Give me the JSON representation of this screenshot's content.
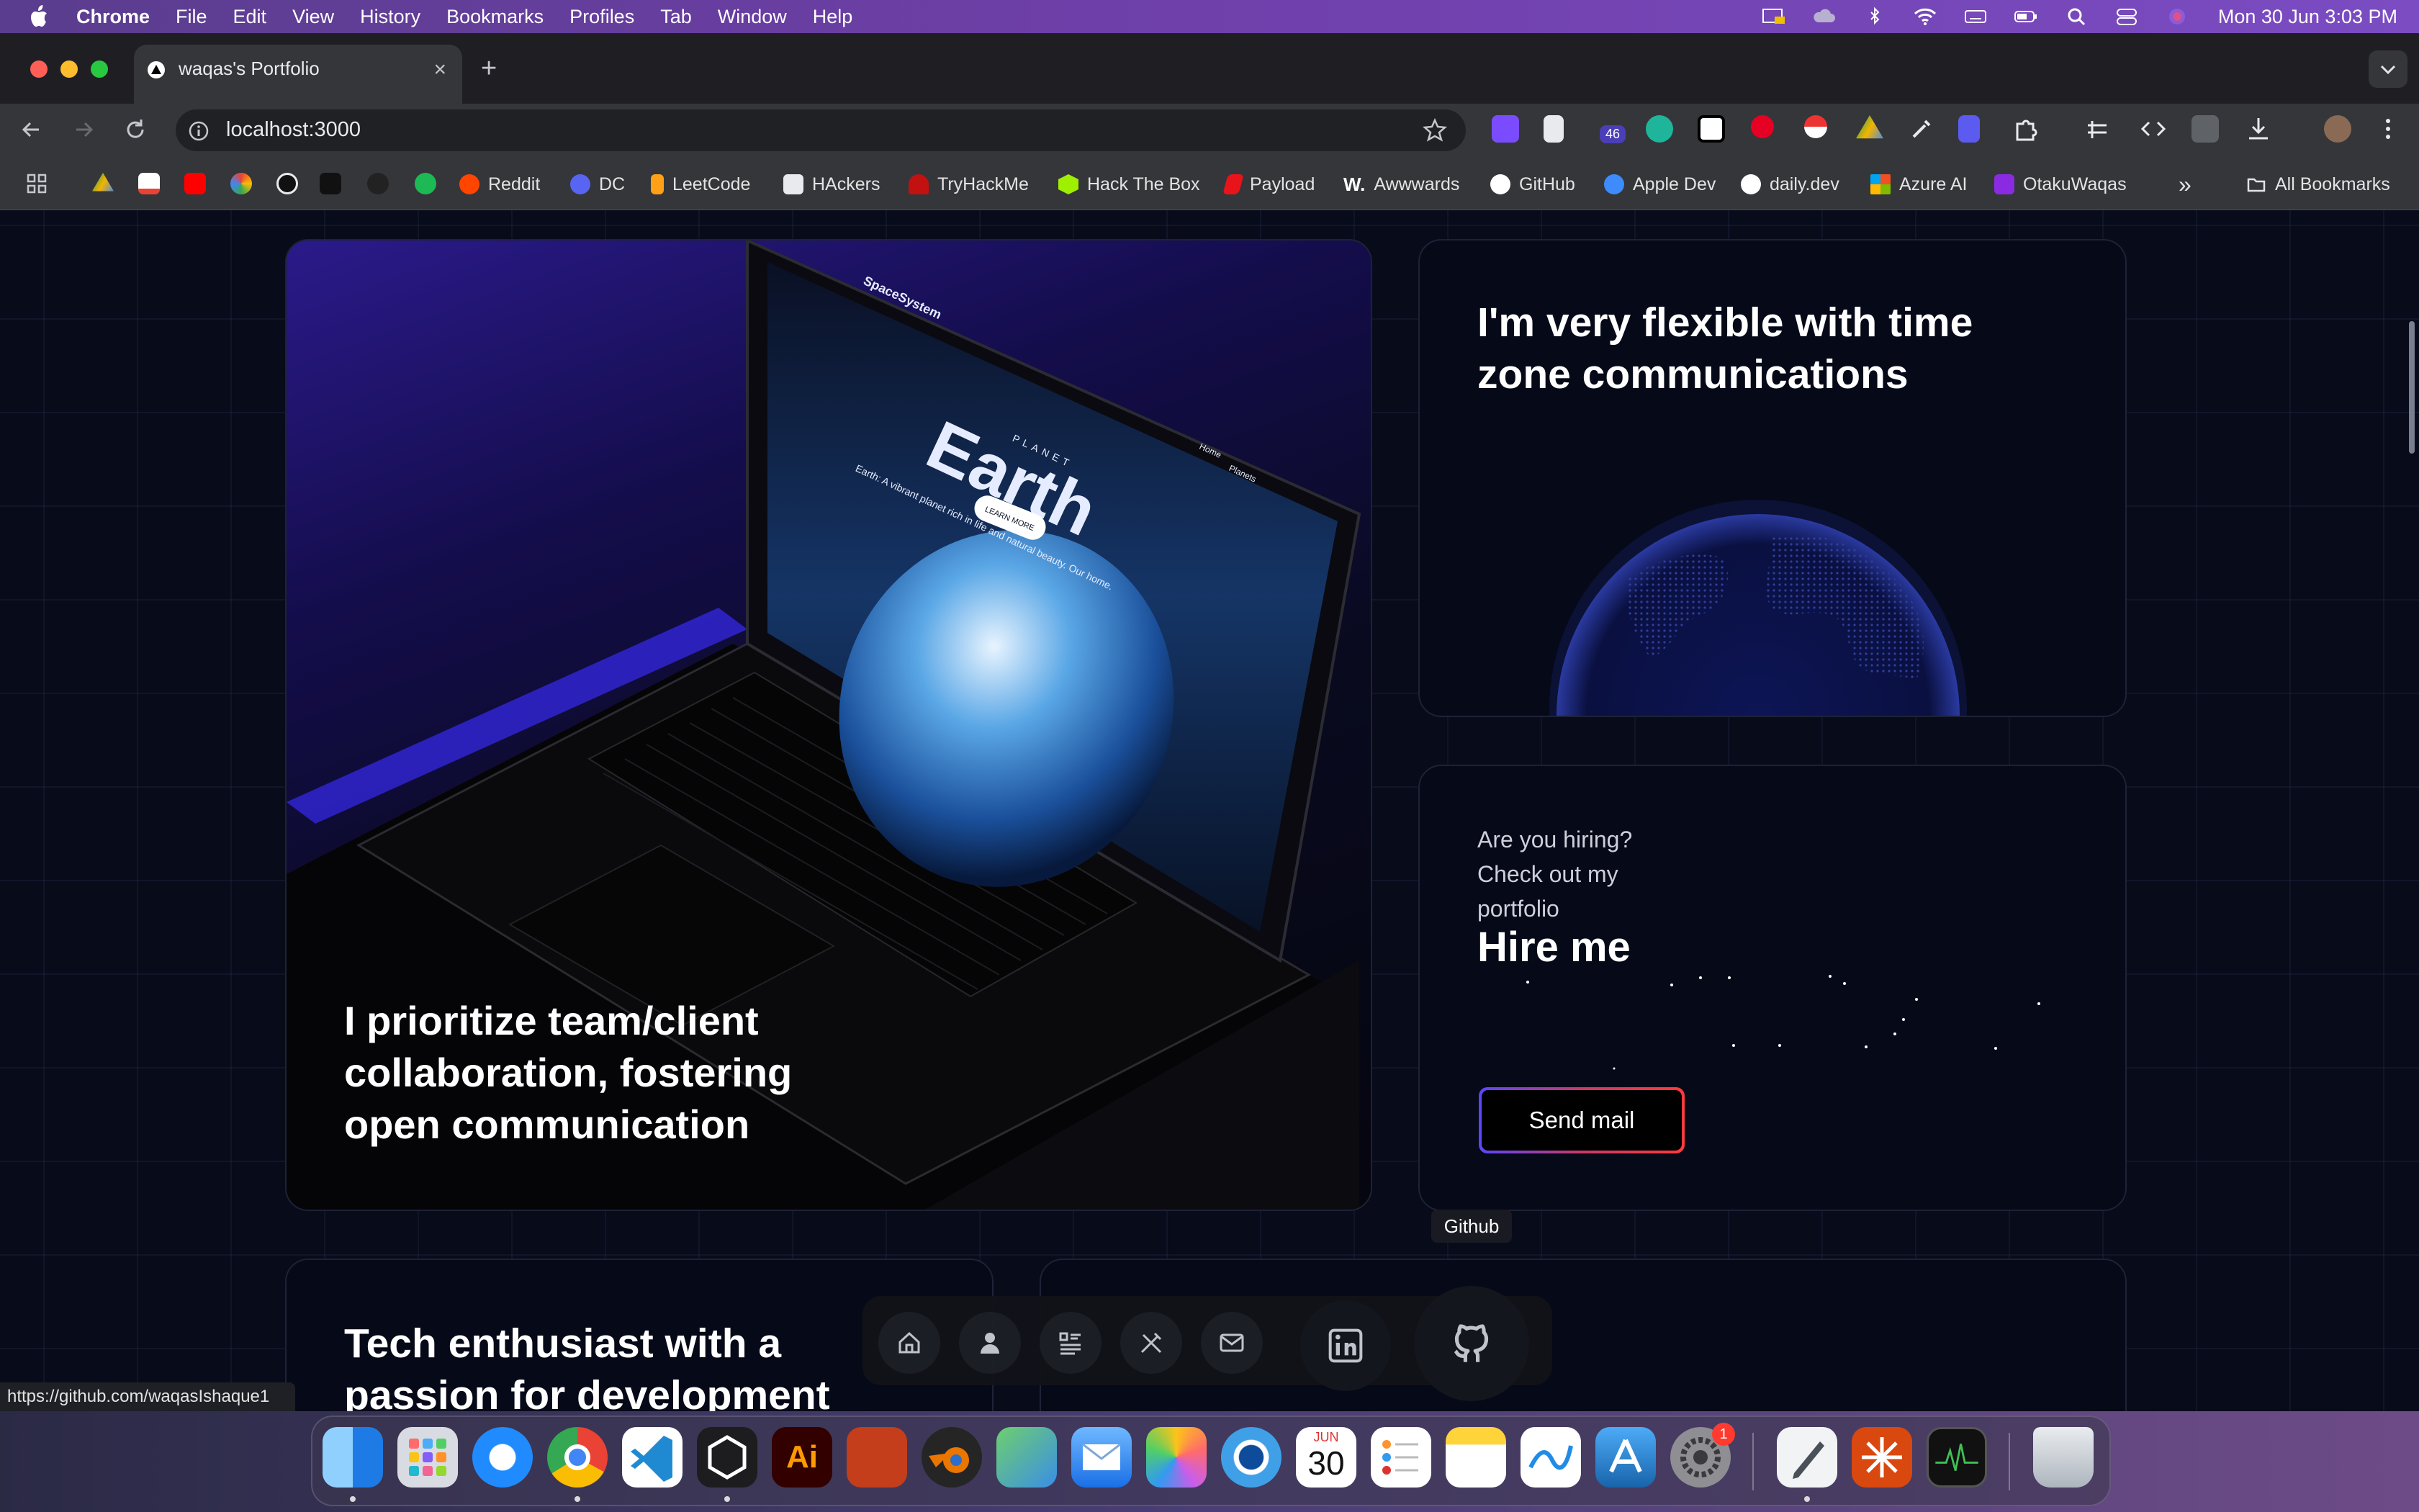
{
  "menubar": {
    "app_name": "Chrome",
    "menus": [
      "File",
      "Edit",
      "View",
      "History",
      "Bookmarks",
      "Profiles",
      "Tab",
      "Window",
      "Help"
    ],
    "clock": "Mon 30 Jun  3:03 PM"
  },
  "browser": {
    "tab_title": "waqas's Portfolio",
    "new_tab_symbol": "+",
    "close_symbol": "×",
    "url": "localhost:3000",
    "extension_badge": "46",
    "bookmarks": [
      "Reddit",
      "DC",
      "LeetCode",
      "HAckers",
      "TryHackMe",
      "Hack The Box",
      "Payload",
      "Awwwards",
      "GitHub",
      "Apple Dev",
      "daily.dev",
      "Azure AI",
      "OtakuWaqas"
    ],
    "all_bookmarks": "All Bookmarks",
    "overflow": "»"
  },
  "page": {
    "card_laptop": {
      "heading": "I prioritize team/client collaboration, fostering open communication",
      "screen_brand": "SpaceSystem",
      "screen_planet_label": "PLANET",
      "screen_title": "Earth",
      "screen_tagline": "Earth: A vibrant planet rich in life and natural beauty. Our home.",
      "screen_button": "LEARN MORE",
      "screen_nav": [
        "Home",
        "Planets"
      ]
    },
    "card_timezone": {
      "heading": "I'm very flexible with time zone communications"
    },
    "card_hire": {
      "subtitle": "Are you hiring? Check out my portfolio",
      "title": "Hire me",
      "button": "Send mail"
    },
    "card_tech": {
      "heading": "Tech enthusiast with a passion for development"
    },
    "tooltip": "Github",
    "status_url": "https://github.com/waqasIshaque1"
  },
  "dock_nav": [
    "home-icon",
    "user-icon",
    "list-icon",
    "tools-icon",
    "mail-icon",
    "linkedin-icon",
    "github-icon"
  ],
  "dock": {
    "calendar_month": "JUN",
    "calendar_day": "30",
    "settings_badge": "1"
  },
  "colors": {
    "menubar": "#6e3fa8",
    "chrome_dark": "#35363a",
    "page_bg": "#080b1a",
    "accent_purple": "#5b46ff",
    "accent_red": "#ff3a3a"
  }
}
